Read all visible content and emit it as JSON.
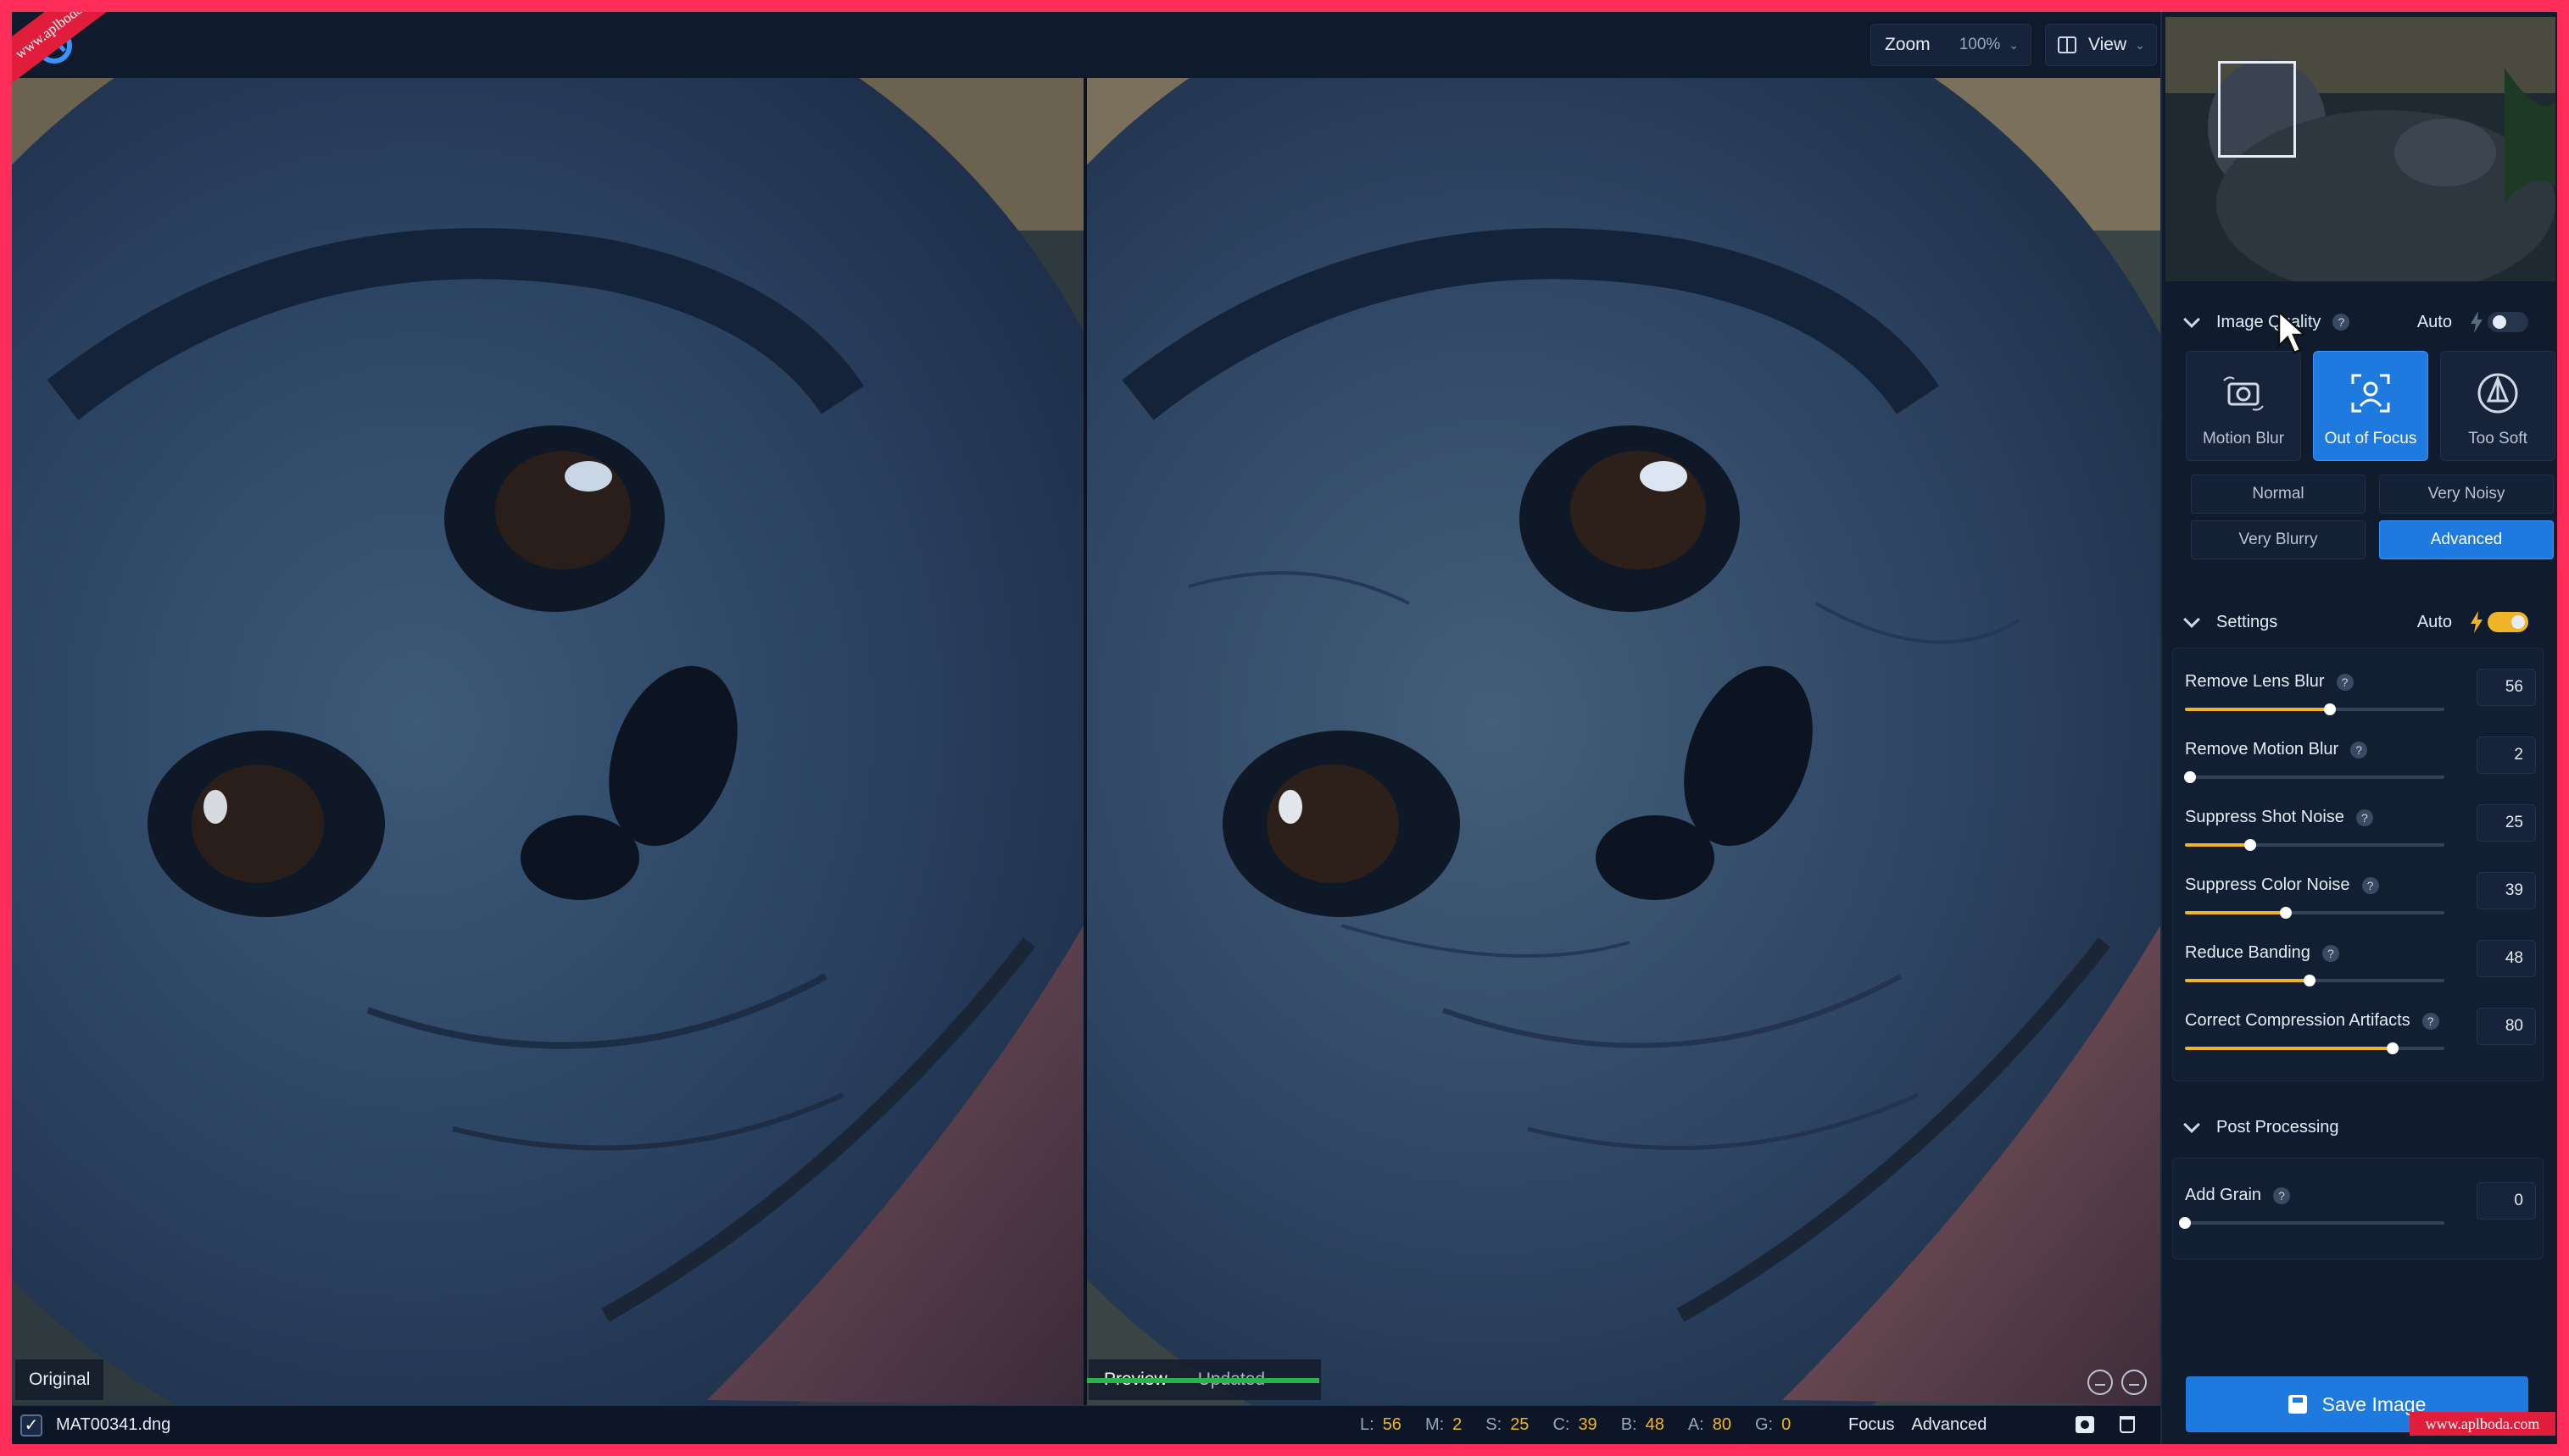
{
  "watermark": {
    "top": "www.aplboda.com",
    "bottom": "www.aplboda.com"
  },
  "toolbar": {
    "zoom_label": "Zoom",
    "zoom_value": "100%",
    "view_label": "View"
  },
  "panes": {
    "left_label": "Original",
    "preview_tabs": [
      "Preview",
      "Updated"
    ]
  },
  "status": {
    "checked": true,
    "filename": "MAT00341.dng",
    "stats": [
      {
        "k": "L:",
        "v": "56"
      },
      {
        "k": "M:",
        "v": "2"
      },
      {
        "k": "S:",
        "v": "25"
      },
      {
        "k": "C:",
        "v": "39"
      },
      {
        "k": "B:",
        "v": "48"
      },
      {
        "k": "A:",
        "v": "80"
      },
      {
        "k": "G:",
        "v": "0"
      }
    ],
    "mode": "Focus",
    "mode_level": "Advanced"
  },
  "image_quality": {
    "title": "Image Quality",
    "auto_label": "Auto",
    "auto_on": false,
    "modes": [
      {
        "label": "Motion Blur",
        "icon": "camera-shake-icon",
        "active": false
      },
      {
        "label": "Out of Focus",
        "icon": "focus-frame-icon",
        "active": true
      },
      {
        "label": "Too Soft",
        "icon": "soft-prism-icon",
        "active": false
      }
    ],
    "options": [
      {
        "label": "Normal",
        "active": false
      },
      {
        "label": "Very Noisy",
        "active": false
      },
      {
        "label": "Very Blurry",
        "active": false
      },
      {
        "label": "Advanced",
        "active": true
      }
    ]
  },
  "settings": {
    "title": "Settings",
    "auto_label": "Auto",
    "auto_on": true,
    "sliders": [
      {
        "label": "Remove Lens Blur",
        "value": "56",
        "fraction": 0.56
      },
      {
        "label": "Remove Motion Blur",
        "value": "2",
        "fraction": 0.02
      },
      {
        "label": "Suppress Shot Noise",
        "value": "25",
        "fraction": 0.25
      },
      {
        "label": "Suppress Color Noise",
        "value": "39",
        "fraction": 0.39
      },
      {
        "label": "Reduce Banding",
        "value": "48",
        "fraction": 0.48
      },
      {
        "label": "Correct Compression Artifacts",
        "value": "80",
        "fraction": 0.8
      }
    ]
  },
  "post_processing": {
    "title": "Post Processing",
    "sliders": [
      {
        "label": "Add Grain",
        "value": "0",
        "fraction": 0.0
      }
    ]
  },
  "save_label": "Save Image",
  "colors": {
    "accent": "#1f7ae0",
    "highlight": "#f0b429",
    "preview_bar": "#2bb24a"
  }
}
